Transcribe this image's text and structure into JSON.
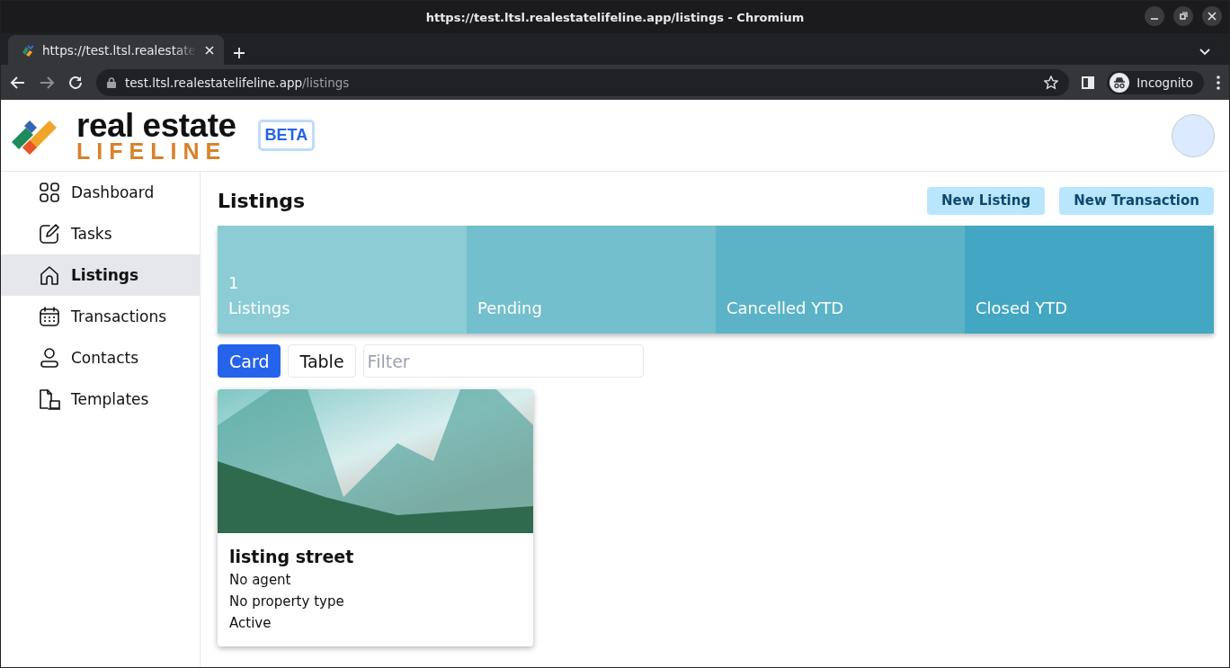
{
  "browser": {
    "window_title": "https://test.ltsl.realestatelifeline.app/listings - Chromium",
    "tabs": [
      {
        "title": "https://test.ltsl.realestate",
        "selected": true
      }
    ],
    "url": {
      "host": "test.ltsl.realestatelifeline.app",
      "path": "/listings"
    },
    "profile": "Incognito"
  },
  "header": {
    "logo": {
      "line1": "real estate",
      "line2": "LIFELINE"
    },
    "badge": "BETA"
  },
  "sidebar": {
    "items": [
      {
        "label": "Dashboard",
        "selected": false
      },
      {
        "label": "Tasks",
        "selected": false
      },
      {
        "label": "Listings",
        "selected": true
      },
      {
        "label": "Transactions",
        "selected": false
      },
      {
        "label": "Contacts",
        "selected": false
      },
      {
        "label": "Templates",
        "selected": false
      }
    ]
  },
  "page": {
    "title": "Listings",
    "actions": [
      "New Listing",
      "New Transaction"
    ],
    "stats": [
      {
        "value": "1",
        "label": "Listings",
        "color": "#8bccd5"
      },
      {
        "label": "Pending",
        "color": "#73bfcd"
      },
      {
        "label": "Cancelled YTD",
        "color": "#5cb3c7"
      },
      {
        "label": "Closed YTD",
        "color": "#43a6c2"
      }
    ],
    "view_toggle": [
      {
        "label": "Card",
        "selected": true
      },
      {
        "label": "Table",
        "selected": false
      }
    ],
    "filter": {
      "placeholder": "Filter"
    },
    "listings": [
      {
        "title": "listing street",
        "agent": "No agent",
        "property_type": "No property type",
        "status": "Active"
      }
    ]
  }
}
